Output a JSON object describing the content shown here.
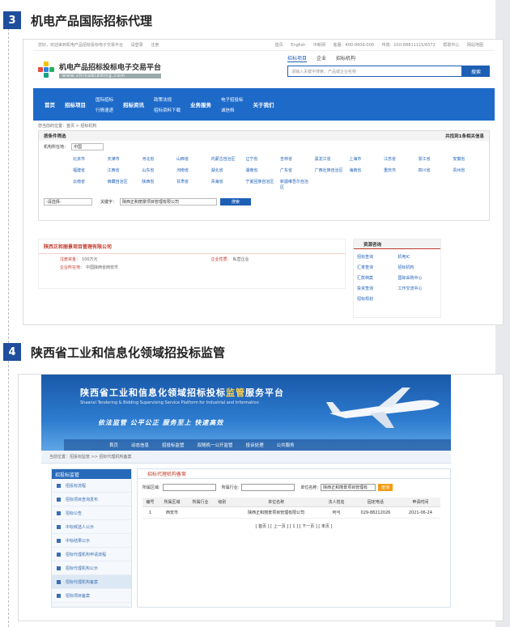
{
  "sections": [
    {
      "num": "3",
      "title": "机电产品国际招标代理"
    },
    {
      "num": "4",
      "title": "陕西省工业和信息化领域招投标监管"
    }
  ],
  "s1": {
    "topbar": {
      "left": [
        "您好，欢迎来到机电产品招标投标电子交易平台",
        "请登录",
        "注册"
      ],
      "right": [
        "首页",
        "English",
        "中新网",
        "客服：400-0606-000",
        "传真：010-88811115/6572",
        "帮助中心",
        "网站地图"
      ]
    },
    "logo": {
      "cn": "机电产品招标投标电子交易平台",
      "en": "www.chinabidding.com"
    },
    "search": {
      "tabs": [
        "招标项目",
        "企业",
        "招标机构"
      ],
      "active_tab": 0,
      "placeholder": "请输入关键字搜索，产品或企业名称",
      "button": "搜索"
    },
    "nav": {
      "items": [
        {
          "type": "single",
          "label": "首页"
        },
        {
          "type": "single",
          "label": "招标项目"
        },
        {
          "type": "stack",
          "labels": [
            "国际招标",
            "行情速递"
          ]
        },
        {
          "type": "single",
          "label": "招标资讯"
        },
        {
          "type": "stack",
          "labels": [
            "政策法规",
            "招标资料下载"
          ]
        },
        {
          "type": "single",
          "label": "业务服务"
        },
        {
          "type": "stack",
          "labels": [
            "电子招投标",
            "诚信档"
          ]
        },
        {
          "type": "single",
          "label": "关于我们"
        }
      ]
    },
    "breadcrumb": "您当前的位置：首页 > 招标机构",
    "filter": {
      "title": "按条件筛选",
      "count": "共找到1条相关信息",
      "region_label": "机构所在地：",
      "region_value": "中国",
      "provinces": [
        "北京市",
        "天津市",
        "河北省",
        "山西省",
        "内蒙古自治区",
        "辽宁省",
        "吉林省",
        "黑龙江省",
        "上海市",
        "江苏省",
        "浙江省",
        "安徽省",
        "福建省",
        "江西省",
        "山东省",
        "河南省",
        "湖北省",
        "湖南省",
        "广东省",
        "广西壮族自治区",
        "海南省",
        "重庆市",
        "四川省",
        "贵州省",
        "云南省",
        "西藏自治区",
        "陕西省",
        "甘肃省",
        "青海省",
        "宁夏回族自治区",
        "新疆维吾尔自治区"
      ],
      "kw_select": "-请选择-",
      "kw_label": "关键字：",
      "kw_value": "陕西正和丽景项目管理有限公司",
      "kw_button": "搜索"
    },
    "result": {
      "name": "陕西正和丽景项目管理有限公司",
      "lines": [
        {
          "k": "注册资金：",
          "v": "100万元",
          "k2": "企业性质：",
          "v2": "私营企业"
        },
        {
          "k": "企业所在地：",
          "v": "中国陕西省西安市"
        }
      ]
    },
    "consult": {
      "title": "资源咨询",
      "items": [
        "招标查询",
        "机电IC",
        "汇率查询",
        "招标机构",
        "汇款档案",
        "国际采购中心",
        "投资查询",
        "工作交流中心",
        "招标规划"
      ]
    }
  },
  "s2": {
    "title_a": "陕西省工业和信息化领域招标投标",
    "title_b": "监管",
    "title_c": "服务平台",
    "title_en": "Shaanxi Tendering & Bidding Supervising Service Platform for Industrial and Information",
    "slogan": "依法监管 公平公正 服务至上 快速高效",
    "nav": [
      "首页",
      "动态信息",
      "招投标监管",
      "双随机一公开监管",
      "投诉处理",
      "公共服务"
    ],
    "breadcrumb": "当前位置：招投标监管 >> 招标代理机构备案",
    "sidebar": {
      "title": "招投标监管",
      "items": [
        "招投标流程",
        "招标项目查询发布",
        "招标公告",
        "中标候选人公示",
        "中标结果公示",
        "招标代理机构申请流程",
        "招标代理机构公示",
        "招标代理机构备案",
        "招标项目备案"
      ],
      "active": 7
    },
    "main": {
      "title": "招标代理机构备案",
      "region_label": "所属区域:",
      "industry_label": "所属行业:",
      "unit_label": "单位名称:",
      "unit_value": "陕西正和丽景项目管理有",
      "query_button": "查询",
      "columns": [
        "编号",
        "所属区域",
        "所属行业",
        "级别",
        "单位名称",
        "法人姓名",
        "固定电话",
        "申请时间"
      ],
      "rows": [
        [
          "1",
          "西安市",
          "",
          "",
          "陕西正和丽景项目管理有限公司",
          "何弓",
          "029-88212026",
          "2021-06-24"
        ]
      ],
      "pager": "[ 首页 ] [ 上一页 ] [ 1 ] [ 下一页 ] [ 末页 ]"
    }
  }
}
